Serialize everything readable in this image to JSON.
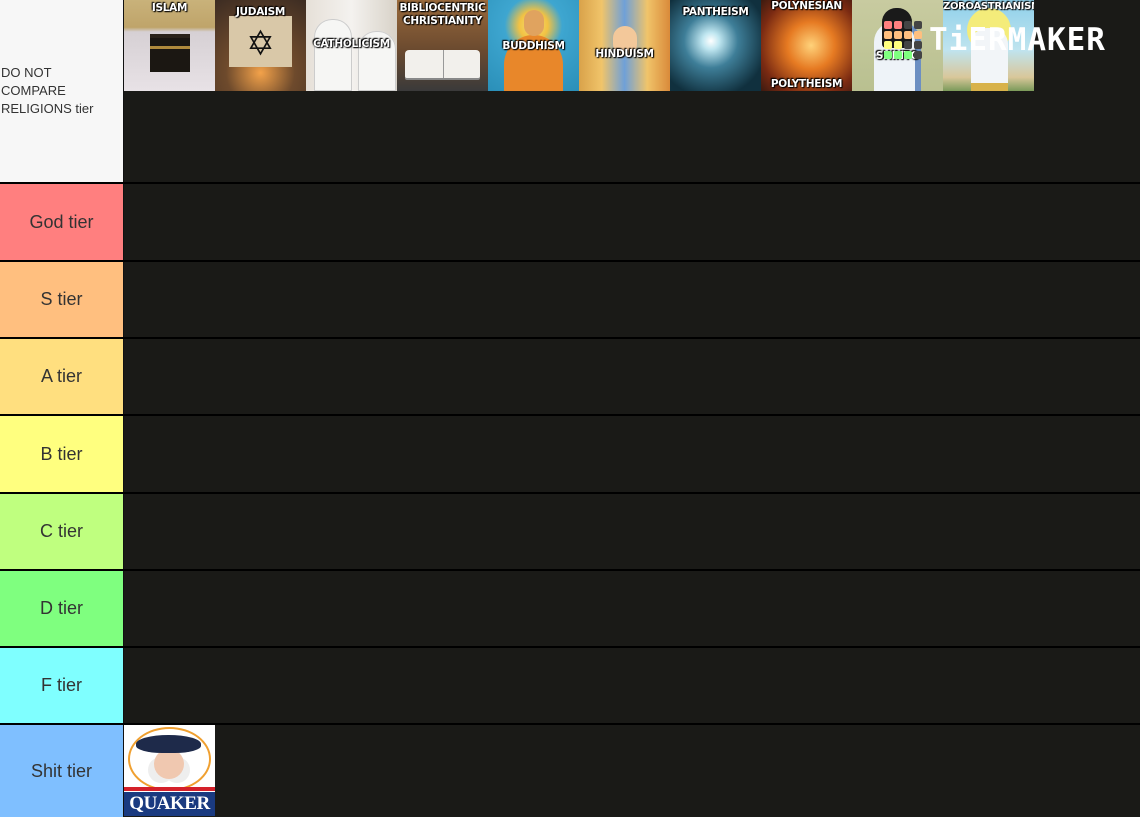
{
  "app": {
    "brand": "TiERMAKER",
    "logo_grid_colors": [
      "#ff7f7f",
      "#ff7f7f",
      "#444444",
      "#444444",
      "#ffbf7f",
      "#ffbf7f",
      "#ffbf7f",
      "#ffbf7f",
      "#ffff7f",
      "#ffff7f",
      "#444444",
      "#444444",
      "#7fff7f",
      "#7fff7f",
      "#7fff7f",
      "#444444"
    ]
  },
  "tiers": [
    {
      "label": "DO NOT COMPARE RELIGIONS tier",
      "color": "#f7f7f7",
      "items": [
        {
          "id": "islam",
          "caption": "ISLAM"
        },
        {
          "id": "judaism",
          "caption": "JUDAISM"
        },
        {
          "id": "catholicism",
          "caption": "CATHOLICISM"
        },
        {
          "id": "bibliocentric",
          "caption": "BIBLIOCENTRIC CHRISTIANITY"
        },
        {
          "id": "buddhism",
          "caption": "BUDDHISM"
        },
        {
          "id": "hinduism",
          "caption": "HINDUISM"
        },
        {
          "id": "pantheism",
          "caption": "PANTHEISM"
        },
        {
          "id": "polynesian",
          "caption": "POLYNESIAN",
          "caption2": "POLYTHEISM"
        },
        {
          "id": "shinto",
          "caption": "SHINTO"
        },
        {
          "id": "zoroastrianism",
          "caption": "ZOROASTRIANISM"
        }
      ]
    },
    {
      "label": "God tier",
      "color": "#ff7f7f",
      "items": []
    },
    {
      "label": "S tier",
      "color": "#ffbf7f",
      "items": []
    },
    {
      "label": "A tier",
      "color": "#ffdf7f",
      "items": []
    },
    {
      "label": "B tier",
      "color": "#ffff7f",
      "items": []
    },
    {
      "label": "C tier",
      "color": "#bfff7f",
      "items": []
    },
    {
      "label": "D tier",
      "color": "#7fff7f",
      "items": []
    },
    {
      "label": "F tier",
      "color": "#7fffff",
      "items": []
    },
    {
      "label": "Shit tier",
      "color": "#7fbfff",
      "items": [
        {
          "id": "quaker",
          "caption": "QUAKER"
        }
      ]
    }
  ],
  "colors": {
    "row_background": "#1a1a17",
    "label_text": "#333333"
  }
}
